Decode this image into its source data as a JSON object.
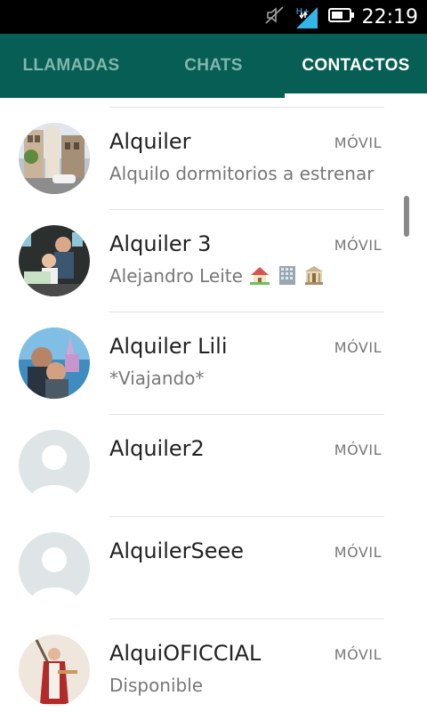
{
  "status_bar": {
    "time": "22:19",
    "network_type": "H+",
    "icons": [
      "mute-icon",
      "signal-icon",
      "battery-icon"
    ]
  },
  "tabs": [
    {
      "label": "LLAMADAS",
      "active": false
    },
    {
      "label": "CHATS",
      "active": false
    },
    {
      "label": "CONTACTOS",
      "active": true
    }
  ],
  "contacts": [
    {
      "name": "Alquiler",
      "type": "MÓVIL",
      "status": "Alquilo dormitorios a estrenar",
      "avatar": "photo-building"
    },
    {
      "name": "Alquiler 3",
      "type": "MÓVIL",
      "status": "Alejandro Leite",
      "status_icons": [
        "house-icon",
        "office-building-icon",
        "classical-building-icon"
      ],
      "avatar": "photo-family"
    },
    {
      "name": "Alquiler Lili",
      "type": "MÓVIL",
      "status": "*Viajando*",
      "avatar": "photo-couple"
    },
    {
      "name": "Alquiler2",
      "type": "MÓVIL",
      "status": "",
      "avatar": "default-avatar"
    },
    {
      "name": "AlquilerSeee",
      "type": "MÓVIL",
      "status": "",
      "avatar": "default-avatar"
    },
    {
      "name": "AlquiOFICCIAL",
      "type": "MÓVIL",
      "status": "Disponible",
      "avatar": "photo-statue"
    }
  ],
  "colors": {
    "tab_bar": "#075e54",
    "tab_inactive_text": "#7fb6ad",
    "tab_active_text": "#ffffff",
    "status_bar": "#000000",
    "network_accent": "#33b5e5"
  }
}
